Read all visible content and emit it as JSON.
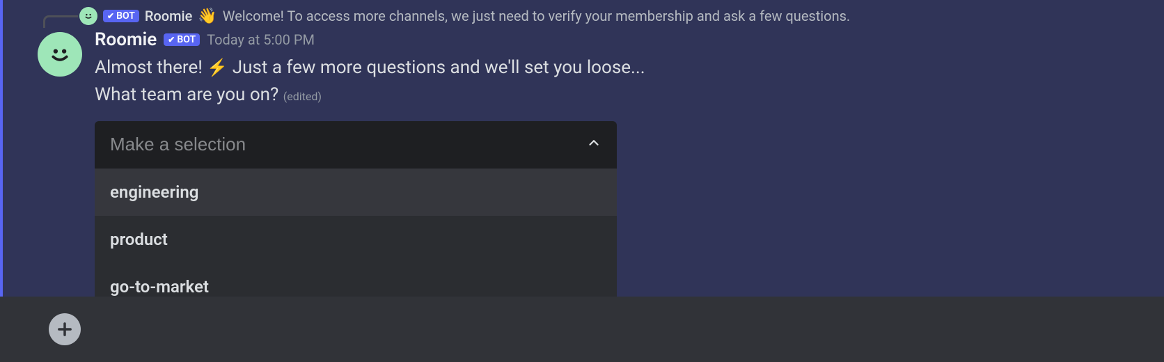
{
  "reply": {
    "username": "Roomie",
    "bot_label": "BOT",
    "wave_emoji": "👋",
    "preview_text": "Welcome! To access more channels, we just need to verify your membership and ask a few questions."
  },
  "message": {
    "username": "Roomie",
    "bot_label": "BOT",
    "timestamp": "Today at 5:00 PM",
    "line1_before": "Almost there!",
    "bolt_emoji": "⚡",
    "line1_after": "Just a few more questions and we'll set you loose...",
    "line2": "What team are you on?",
    "edited_label": "(edited)"
  },
  "select": {
    "placeholder": "Make a selection",
    "options": [
      "engineering",
      "product",
      "go-to-market"
    ]
  }
}
